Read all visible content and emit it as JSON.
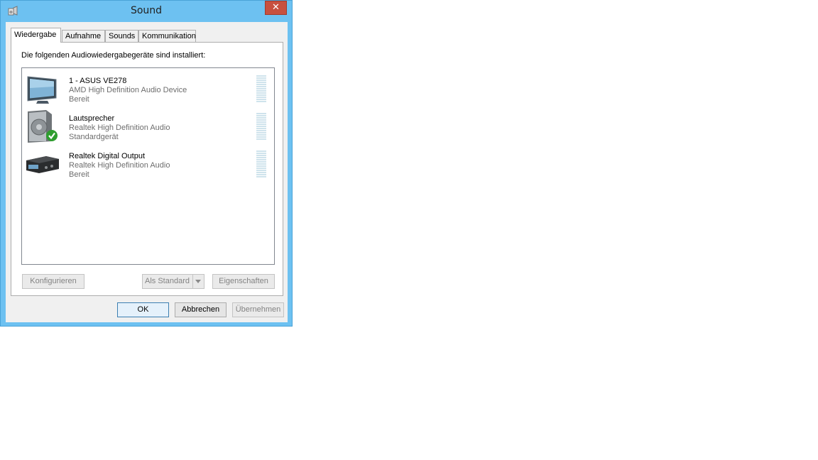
{
  "window": {
    "title": "Sound",
    "close_glyph": "✕"
  },
  "tabs": [
    {
      "label": "Wiedergabe",
      "active": true
    },
    {
      "label": "Aufnahme",
      "active": false
    },
    {
      "label": "Sounds",
      "active": false
    },
    {
      "label": "Kommunikation",
      "active": false
    }
  ],
  "panel": {
    "intro": "Die folgenden Audiowiedergabegeräte sind installiert:",
    "devices": [
      {
        "name": "1 - ASUS VE278",
        "driver": "AMD High Definition Audio Device",
        "status": "Bereit",
        "icon": "monitor-icon"
      },
      {
        "name": "Lautsprecher",
        "driver": "Realtek High Definition Audio",
        "status": "Standardgerät",
        "icon": "speaker-icon",
        "default": true
      },
      {
        "name": "Realtek Digital Output",
        "driver": "Realtek High Definition Audio",
        "status": "Bereit",
        "icon": "digital-output-icon"
      }
    ],
    "buttons": {
      "configure": "Konfigurieren",
      "set_default": "Als Standard",
      "properties": "Eigenschaften"
    }
  },
  "footer": {
    "ok": "OK",
    "cancel": "Abbrechen",
    "apply": "Übernehmen"
  },
  "colors": {
    "title_bar": "#6dc1f1",
    "close_button": "#c7503f",
    "check_badge": "#2e9e2e"
  }
}
